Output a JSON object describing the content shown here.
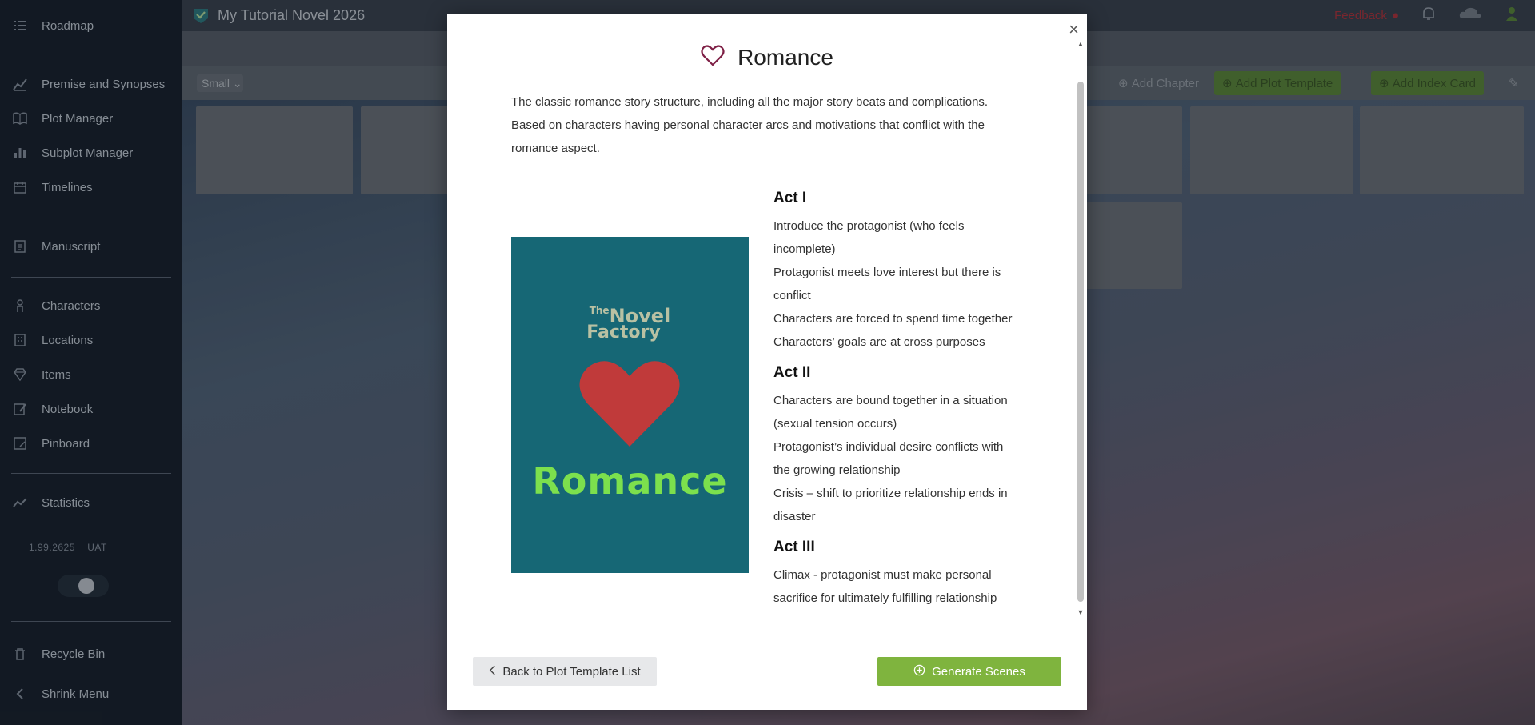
{
  "app": {
    "project_title": "My Tutorial Novel 2026",
    "feedback_label": "Feedback",
    "version": "1.99.2625",
    "env": "UAT"
  },
  "sidebar": {
    "items": [
      {
        "label": "Roadmap",
        "icon": "list-icon"
      },
      {
        "label": "Premise and Synopses",
        "icon": "chart-icon"
      },
      {
        "label": "Plot Manager",
        "icon": "book-icon"
      },
      {
        "label": "Subplot Manager",
        "icon": "bars-icon"
      },
      {
        "label": "Timelines",
        "icon": "calendar-icon"
      },
      {
        "label": "Manuscript",
        "icon": "document-icon"
      },
      {
        "label": "Characters",
        "icon": "person-icon"
      },
      {
        "label": "Locations",
        "icon": "building-icon"
      },
      {
        "label": "Items",
        "icon": "gem-icon"
      },
      {
        "label": "Notebook",
        "icon": "notebook-icon"
      },
      {
        "label": "Pinboard",
        "icon": "pin-icon"
      },
      {
        "label": "Statistics",
        "icon": "stats-icon"
      },
      {
        "label": "Recycle Bin",
        "icon": "trash-icon"
      },
      {
        "label": "Shrink Menu",
        "icon": "chevron-left-icon"
      }
    ]
  },
  "toolbar": {
    "size_value": "Small",
    "add_chapter": "Add Chapter",
    "add_plot_template": "Add Plot Template",
    "add_index_card": "Add Index Card"
  },
  "modal": {
    "title": "Romance",
    "description": "The classic romance story structure, including all the major story beats and complications. Based on characters having personal character arcs and motivations that conflict with the romance aspect.",
    "cover": {
      "logo_the": "The",
      "logo_novel": "Novel",
      "logo_factory": "Factory",
      "word": "Romance",
      "bg_color": "#166775",
      "word_color": "#7ce04d"
    },
    "acts": [
      {
        "heading": "Act I",
        "beats": [
          "Introduce the protagonist (who feels incomplete)",
          "Protagonist meets love interest but there is conflict",
          "Characters are forced to spend time together",
          "Characters’ goals are at cross purposes"
        ]
      },
      {
        "heading": "Act II",
        "beats": [
          "Characters are bound together in a situation (sexual tension occurs)",
          "Protagonist’s individual desire conflicts with the growing relationship",
          "Crisis – shift to prioritize relationship ends in disaster"
        ]
      },
      {
        "heading": "Act III",
        "beats": [
          "Climax - protagonist must make personal sacrifice for ultimately fulfilling relationship"
        ]
      }
    ],
    "back_button": "Back to Plot Template List",
    "generate_button": "Generate Scenes",
    "accent_color": "#7fb43e"
  }
}
